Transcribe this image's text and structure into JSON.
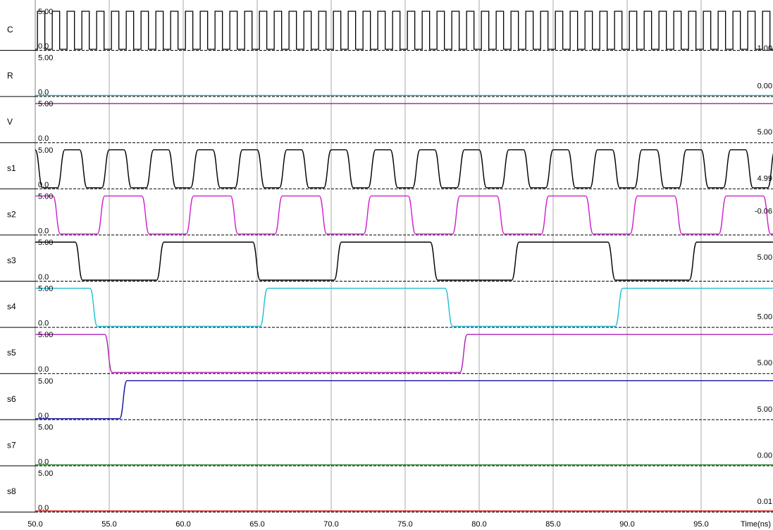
{
  "chart_data": {
    "type": "line",
    "title": "",
    "xlabel": "Time(ns)",
    "ylabel": "",
    "xlim": [
      50.0,
      99.9
    ],
    "x_ticks": [
      "50.0",
      "55.0",
      "60.0",
      "65.0",
      "70.0",
      "75.0",
      "80.0",
      "85.0",
      "90.0",
      "95.0"
    ],
    "grid": true,
    "series": [
      {
        "name": "C",
        "color": "#000000",
        "y_top_label": "5.00",
        "y_bottom_label": "0.0",
        "end_value": "1.00",
        "kind": "clock",
        "period_ns": 1.0,
        "first_rise_ns": 50.15,
        "low_before_first_rise": true
      },
      {
        "name": "R",
        "color": "#00b8c8",
        "y_top_label": "5.00",
        "y_bottom_label": "0.0",
        "end_value": "0.00",
        "initial": 0,
        "edges": []
      },
      {
        "name": "V",
        "color": "#a0209a",
        "y_top_label": "5.00",
        "y_bottom_label": "0.0",
        "end_value": "5.00",
        "initial": 5,
        "edges": []
      },
      {
        "name": "s1",
        "color": "#000000",
        "y_top_label": "5.00",
        "y_bottom_label": "0.0",
        "end_value": "4.99",
        "kind": "toggle",
        "initial": 5,
        "start_edge_ns": 50.0,
        "toggle_period_ns": 1.5,
        "rise_ns": 0.5
      },
      {
        "name": "s2",
        "color": "#d020d0",
        "y_top_label": "5.00",
        "y_bottom_label": "0.0",
        "end_value": "-0.06",
        "kind": "toggle",
        "initial": 5,
        "start_edge_ns": 51.2,
        "toggle_period_ns": 3.0,
        "rise_ns": 0.5
      },
      {
        "name": "s3",
        "color": "#000000",
        "y_top_label": "5.00",
        "y_bottom_label": "0.0",
        "end_value": "5.00",
        "initial": 5,
        "rise_ns": 0.5,
        "edges": [
          52.7,
          58.2,
          64.7,
          70.2,
          76.7,
          82.2,
          88.7,
          94.2
        ]
      },
      {
        "name": "s4",
        "color": "#20c0d8",
        "y_top_label": "5.00",
        "y_bottom_label": "0.0",
        "end_value": "5.00",
        "initial": 5,
        "rise_ns": 0.5,
        "edges": [
          53.7,
          65.2,
          77.7,
          89.2
        ]
      },
      {
        "name": "s5",
        "color": "#b020b8",
        "y_top_label": "5.00",
        "y_bottom_label": "0.0",
        "end_value": "5.00",
        "initial": 5,
        "rise_ns": 0.5,
        "edges": [
          54.7,
          78.7
        ]
      },
      {
        "name": "s6",
        "color": "#1010a0",
        "y_top_label": "5.00",
        "y_bottom_label": "0.0",
        "end_value": "5.00",
        "initial": 0,
        "rise_ns": 0.5,
        "edges": [
          55.7
        ]
      },
      {
        "name": "s7",
        "color": "#208020",
        "y_top_label": "5.00",
        "y_bottom_label": "0.0",
        "end_value": "0.00",
        "initial": 0,
        "edges": []
      },
      {
        "name": "s8",
        "color": "#d01010",
        "y_top_label": "5.00",
        "y_bottom_label": "0.0",
        "end_value": "0.01",
        "initial": 0,
        "edges": []
      }
    ]
  }
}
